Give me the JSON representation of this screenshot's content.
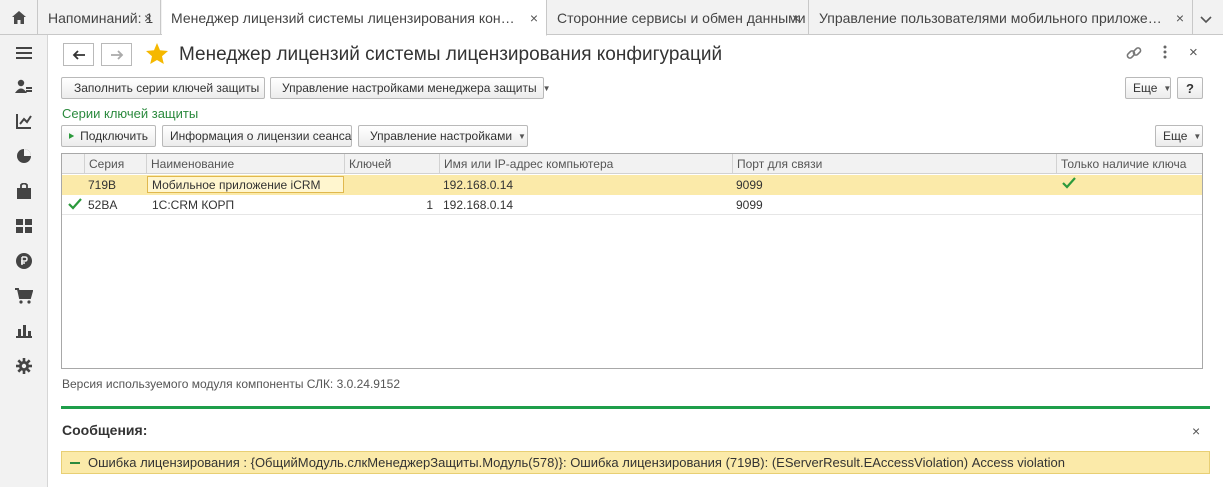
{
  "tabs": [
    {
      "label": "Напоминаний: 1",
      "closable": true,
      "active": false
    },
    {
      "label": "Менеджер лицензий системы лицензирования конфигу...",
      "closable": true,
      "active": true
    },
    {
      "label": "Сторонние сервисы и обмен данными",
      "closable": true,
      "active": false
    },
    {
      "label": "Управление пользователями мобильного приложения (i...",
      "closable": true,
      "active": false
    }
  ],
  "close_glyph": "×",
  "sidebar_icons": [
    "menu-icon",
    "users-icon",
    "org-chart-icon",
    "pie-chart-icon",
    "bag-icon",
    "grid-icon",
    "ruble-icon",
    "cart-icon",
    "bar-chart-icon",
    "gear-icon"
  ],
  "window": {
    "title": "Менеджер лицензий системы лицензирования конфигураций",
    "more_label": "Еще",
    "help_label": "?"
  },
  "toolbar": {
    "fill_series_label": "Заполнить серии ключей защиты",
    "manage_manager_label": "Управление настройками менеджера защиты"
  },
  "section": {
    "title": "Серии ключей защиты",
    "connect_label": "Подключить",
    "license_info_label": "Информация о лицензии сеанса",
    "manage_settings_label": "Управление настройками",
    "more_label": "Еще"
  },
  "table": {
    "columns": [
      "Серия",
      "Наименование",
      "Ключей",
      "Имя или IP-адрес компьютера",
      "Порт для связи",
      "Только наличие ключа"
    ],
    "rows": [
      {
        "series": "719B",
        "name": "Мобильное приложение iCRM",
        "keys": "",
        "host": "192.168.0.14",
        "port": "9099",
        "only_key": true,
        "connected": false
      },
      {
        "series": "52BA",
        "name": "1С:CRM КОРП",
        "keys": "1",
        "host": "192.168.0.14",
        "port": "9099",
        "only_key": false,
        "connected": true
      }
    ]
  },
  "footer": {
    "version_text": "Версия используемого модуля компоненты СЛК: 3.0.24.9152"
  },
  "messages": {
    "title": "Сообщения:",
    "items": [
      "Ошибка лицензирования : {ОбщийМодуль.слкМенеджерЗащиты.Модуль(578)}: Ошибка лицензирования (719B): (EServerResult.EAccessViolation) Access violation"
    ]
  },
  "colors": {
    "accent_green": "#1e9e4a",
    "selection_yellow": "#fbeaa9",
    "star_yellow": "#f5b800"
  }
}
